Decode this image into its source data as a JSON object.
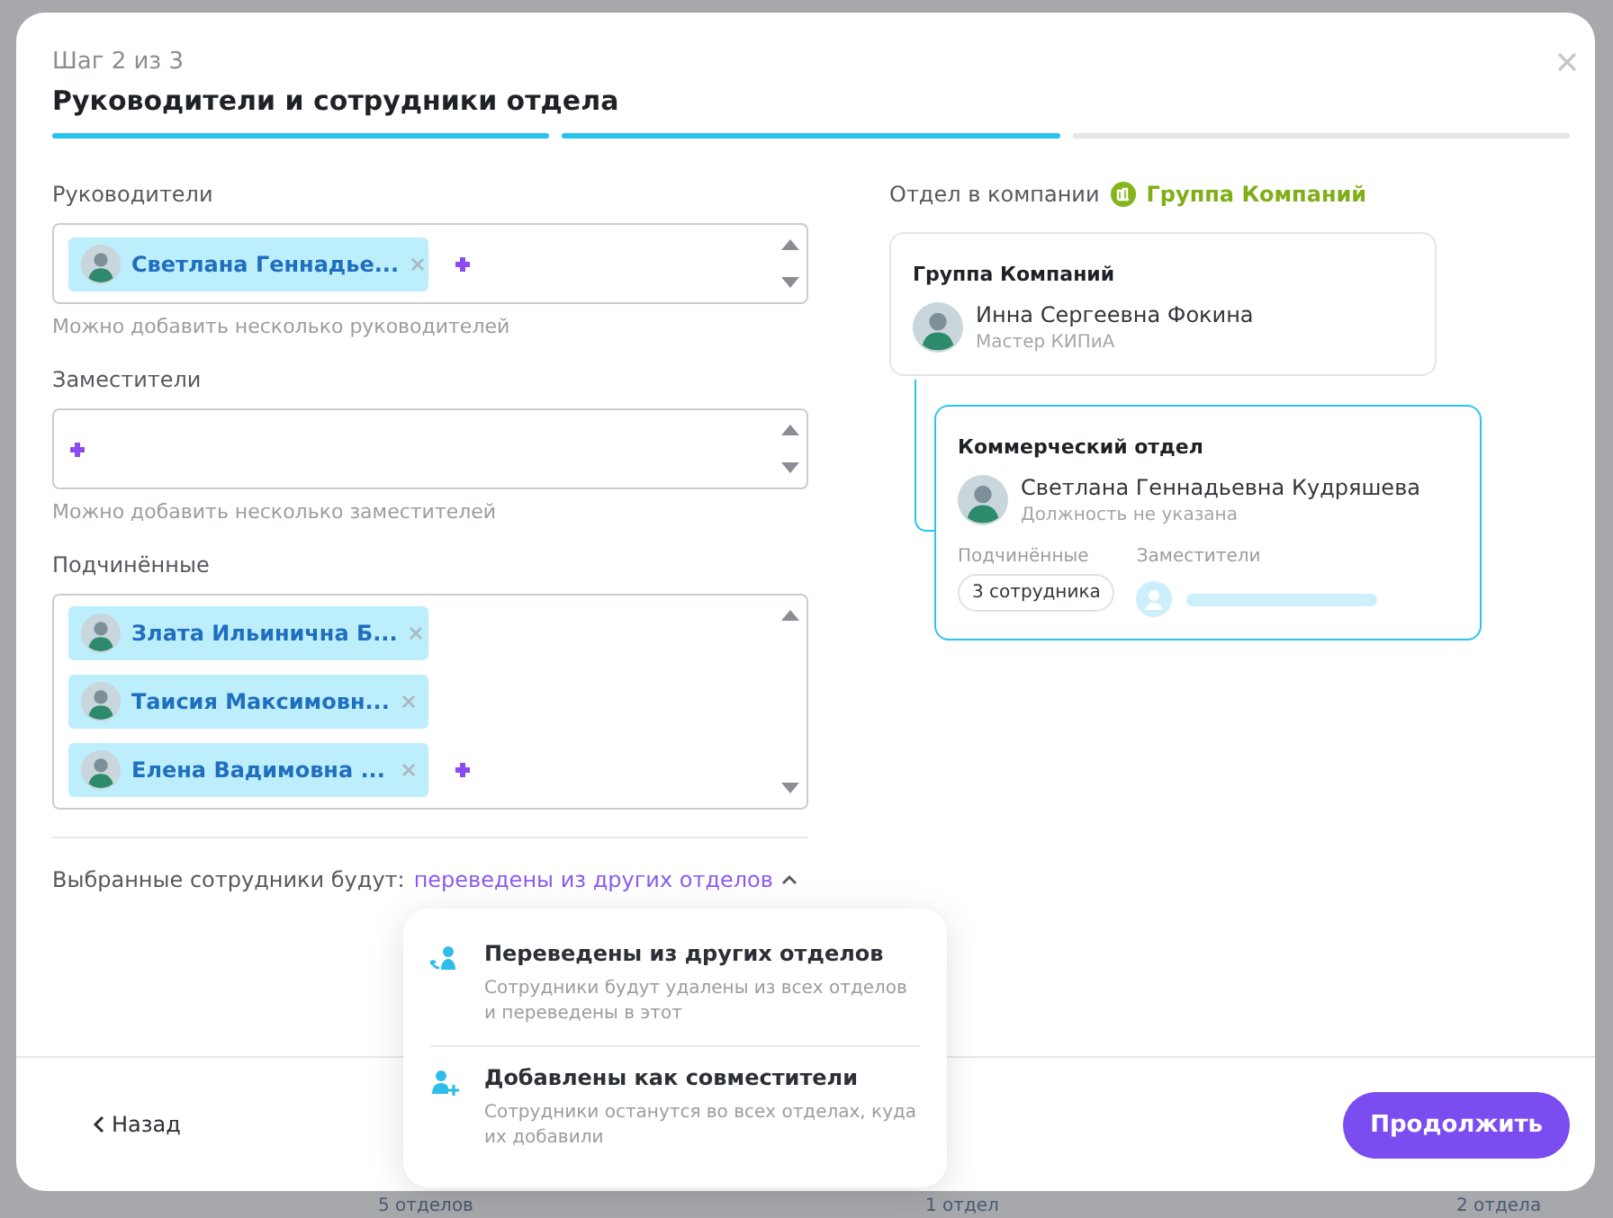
{
  "backdrop": {
    "counters": [
      "5 отделов",
      "1 отдел",
      "2 отдела"
    ]
  },
  "dialog": {
    "step": "Шаг 2 из 3",
    "title": "Руководители и сотрудники отдела",
    "progress": [
      {
        "done": true
      },
      {
        "done": true
      },
      {
        "done": false
      }
    ]
  },
  "fields": [
    {
      "label": "Руководители",
      "chips": [
        "Светлана Геннадье..."
      ],
      "hint": "Можно добавить несколько руководителей"
    },
    {
      "label": "Заместители",
      "hint": "Можно добавить несколько заместителей"
    },
    {
      "label": "Подчинённые",
      "chips": [
        "Злата Ильинична Б...",
        "Таисия Максимовн...",
        "Елена Вадимовна ..."
      ]
    }
  ],
  "mode": {
    "label": "Выбранные сотрудники будут:",
    "value": "переведены из других отделов",
    "expanded": true
  },
  "mode_options": [
    {
      "kind": "transfer",
      "title": "Переведены из других отделов",
      "description": "Сотрудники будут удалены из всех отделов и переведены в этот"
    },
    {
      "kind": "add",
      "title": "Добавлены как совместители",
      "description": "Сотрудники останутся во всех отделах, куда их добавили"
    }
  ],
  "company": {
    "label": "Отдел в компании",
    "name": "Группа Компаний"
  },
  "org_chart": [
    {
      "title": "Группа Компаний",
      "person": "Инна Сергеевна Фокина",
      "position": "Мастер КИПиА",
      "highlighted": false
    },
    {
      "title": "Коммерческий отдел",
      "person": "Светлана Геннадьевна Кудряшева",
      "position": "Должность не указана",
      "highlighted": true,
      "subordinates_label": "Подчинённые",
      "subordinates": "3 сотрудника",
      "deputies_label": "Заместители"
    }
  ],
  "footer": {
    "back": "Назад",
    "next": "Продолжить"
  }
}
